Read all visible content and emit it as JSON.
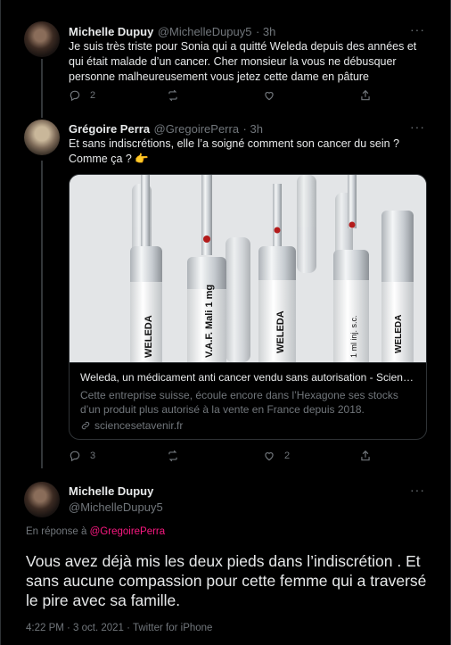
{
  "tweet1": {
    "name": "Michelle Dupuy",
    "handle": "@MichelleDupuy5",
    "time": "· 3h",
    "text": "Je suis très triste pour Sonia qui a quitté Weleda depuis des années et qui était malade d’un cancer. Cher monsieur la vous ne débusquer personne malheureusement vous jetez cette dame en pâture",
    "reply_count": "2",
    "retweet_count": "",
    "like_count": ""
  },
  "tweet2": {
    "name": "Grégoire Perra",
    "handle": "@GregoirePerra",
    "time": "· 3h",
    "text": "Et sans indiscrétions, elle l’a soigné comment son cancer du sein ? Comme ça ? 👉",
    "card": {
      "title": "Weleda, un médicament anti cancer vendu sans autorisation - Scienc...",
      "description": "Cette entreprise suisse, écoule encore dans l’Hexagone ses stocks d’un produit plus autorisé à la vente en France depuis 2018.",
      "domain": "sciencesetavenir.fr",
      "ampoule_labels": [
        "WELEDA",
        "V.A.F. Mali 1 mg",
        "WELEDA",
        "1 ml inj. s.c.",
        "WELEDA"
      ]
    },
    "reply_count": "3",
    "retweet_count": "",
    "like_count": "2"
  },
  "tweet3": {
    "name": "Michelle Dupuy",
    "handle": "@MichelleDupuy5",
    "reply_prefix": "En réponse à",
    "reply_to": "@GregoirePerra",
    "text": "Vous avez déjà mis les deux pieds dans l’indiscrétion . Et sans aucune compassion pour cette femme qui a traversé le pire avec sa famille.",
    "timestamp": "4:22 PM · 3 oct. 2021 · Twitter for iPhone"
  },
  "icons": [
    "more-icon",
    "reply-icon",
    "retweet-icon",
    "like-icon",
    "share-icon",
    "link-icon"
  ]
}
